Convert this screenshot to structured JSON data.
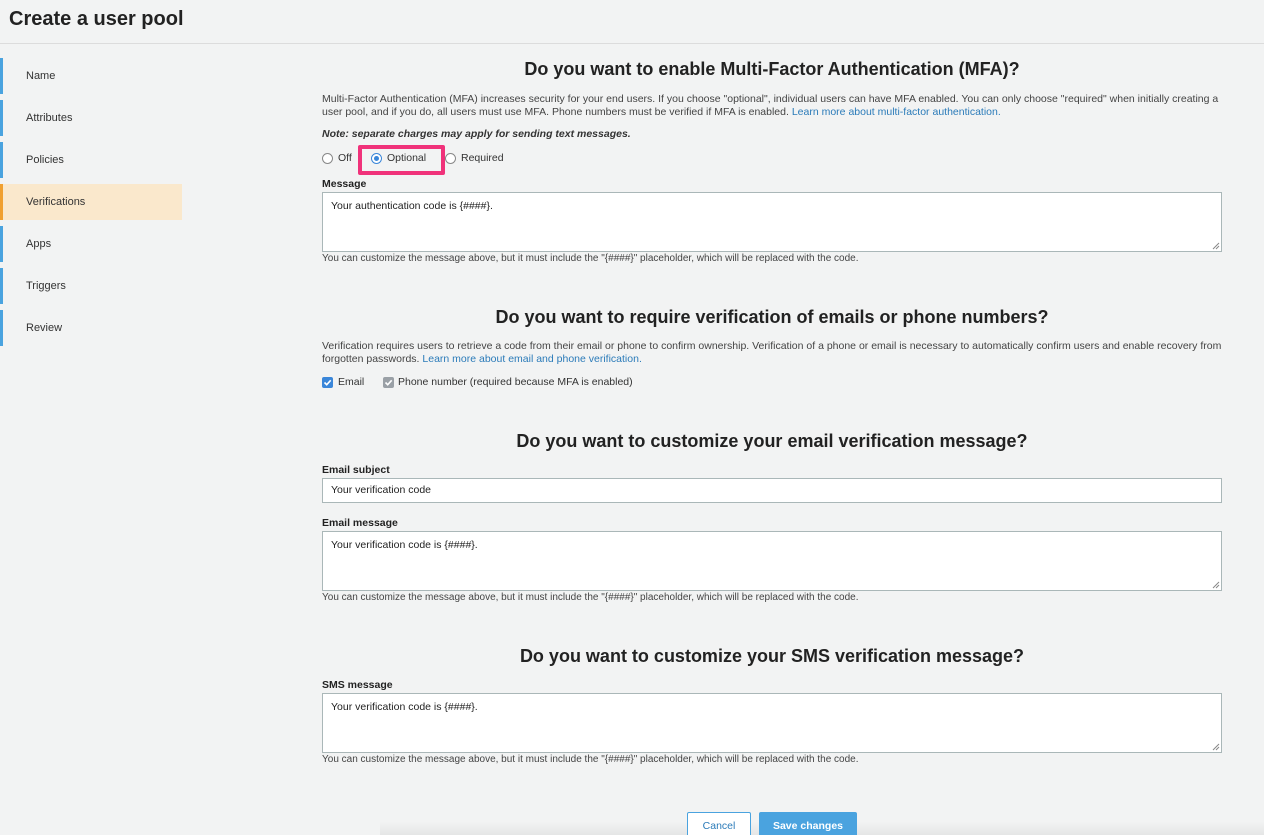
{
  "page": {
    "title": "Create a user pool"
  },
  "sidebar": {
    "items": [
      {
        "label": "Name"
      },
      {
        "label": "Attributes"
      },
      {
        "label": "Policies"
      },
      {
        "label": "Verifications",
        "active": true
      },
      {
        "label": "Apps"
      },
      {
        "label": "Triggers"
      },
      {
        "label": "Review"
      }
    ]
  },
  "mfa": {
    "title": "Do you want to enable Multi-Factor Authentication (MFA)?",
    "description": "Multi-Factor Authentication (MFA) increases security for your end users. If you choose \"optional\", individual users can have MFA enabled. You can only choose \"required\" when initially creating a user pool, and if you do, all users must use MFA. Phone numbers must be verified if MFA is enabled.",
    "link": "Learn more about multi-factor authentication.",
    "note": "Note: separate charges may apply for sending text messages.",
    "options": [
      {
        "label": "Off",
        "selected": false
      },
      {
        "label": "Optional",
        "selected": true
      },
      {
        "label": "Required",
        "selected": false
      }
    ],
    "message_label": "Message",
    "message_value": "Your authentication code is {####}.",
    "hint": "You can customize the message above, but it must include the \"{####}\" placeholder, which will be replaced with the code."
  },
  "verification": {
    "title": "Do you want to require verification of emails or phone numbers?",
    "description": "Verification requires users to retrieve a code from their email or phone to confirm ownership. Verification of a phone or email is necessary to automatically confirm users and enable recovery from forgotten passwords.",
    "link": "Learn more about email and phone verification.",
    "email_label": "Email",
    "email_checked": true,
    "phone_label": "Phone number (required because MFA is enabled)",
    "phone_checked": true
  },
  "email_msg": {
    "title": "Do you want to customize your email verification message?",
    "subject_label": "Email subject",
    "subject_value": "Your verification code",
    "message_label": "Email message",
    "message_value": "Your verification code is {####}.",
    "hint": "You can customize the message above, but it must include the \"{####}\" placeholder, which will be replaced with the code."
  },
  "sms_msg": {
    "title": "Do you want to customize your SMS verification message?",
    "message_label": "SMS message",
    "message_value": "Your verification code is {####}.",
    "hint": "You can customize the message above, but it must include the \"{####}\" placeholder, which will be replaced with the code."
  },
  "actions": {
    "cancel": "Cancel",
    "save": "Save changes"
  },
  "colors": {
    "accent": "#4aa3df",
    "active_nav": "#fae8cc",
    "highlight": "#f0327a",
    "link": "#2b7bb9"
  }
}
